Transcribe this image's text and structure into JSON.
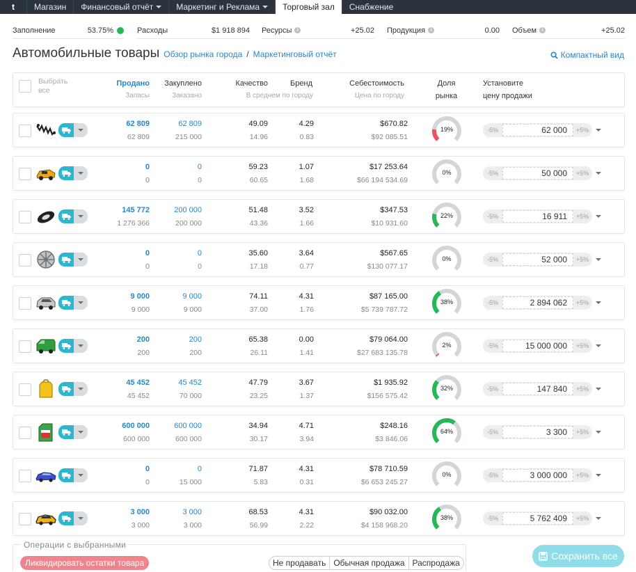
{
  "nav": {
    "logo": "t",
    "tabs": [
      {
        "label": "Магазин",
        "dropdown": false,
        "active": false
      },
      {
        "label": "Финансовый отчёт",
        "dropdown": true,
        "active": false
      },
      {
        "label": "Маркетинг и Реклама",
        "dropdown": true,
        "active": false
      },
      {
        "label": "Торговый зал",
        "dropdown": false,
        "active": true
      },
      {
        "label": "Снабжение",
        "dropdown": false,
        "active": false
      }
    ]
  },
  "stats": [
    {
      "label": "Заполнение",
      "value": "53.75%",
      "info": false,
      "dot": true
    },
    {
      "label": "Расходы",
      "value": "$1 918 894",
      "info": false,
      "dot": false
    },
    {
      "label": "Ресурсы",
      "value": "+25.02",
      "info": true,
      "dot": false
    },
    {
      "label": "Продукция",
      "value": "0.00",
      "info": true,
      "dot": false
    },
    {
      "label": "Объем",
      "value": "+25.02",
      "info": true,
      "dot": false
    }
  ],
  "heading": {
    "title": "Автомобильные товары",
    "link1": "Обзор рынка города",
    "sep": "/",
    "link2": "Маркетинговый отчёт",
    "compact": "Компактный вид"
  },
  "header": {
    "select": "Выбрать",
    "select2": "все",
    "sold": "Продано",
    "stock": "Запасы",
    "bought": "Закуплено",
    "ordered": "Заказано",
    "quality": "Качество",
    "brand": "Бренд",
    "avg": "В среднем по городу",
    "cost": "Себестоимость",
    "cityprice": "Цена по городу",
    "share1": "Доля",
    "share2": "рынка",
    "setprice1": "Установите",
    "setprice2": "цену продажи"
  },
  "rows": [
    {
      "icon": "spark-plug-wires",
      "sold": "62 809",
      "stock": "62 809",
      "bought": "62 809",
      "ordered": "215 000",
      "quality": "49.09",
      "quality_avg": "14.96",
      "brand": "4.29",
      "brand_avg": "0.83",
      "cost": "$670.82",
      "city_price": "$92 085.51",
      "share_label": "19%",
      "share": 19,
      "minus": "-5%",
      "price": "62 000",
      "plus": "+5%"
    },
    {
      "icon": "toy-car",
      "sold": "0",
      "stock": "0",
      "bought": "0",
      "ordered": "0",
      "quality": "59.23",
      "quality_avg": "60.65",
      "brand": "1.07",
      "brand_avg": "1.68",
      "cost": "$17 253.64",
      "city_price": "$66 194 534.69",
      "share_label": "0%",
      "share": 0,
      "minus": "-5%",
      "price": "50 000",
      "plus": "+5%"
    },
    {
      "icon": "tire",
      "sold": "145 772",
      "stock": "1 276 366",
      "bought": "200 000",
      "ordered": "200 000",
      "quality": "51.48",
      "quality_avg": "43.36",
      "brand": "3.52",
      "brand_avg": "1.66",
      "cost": "$347.53",
      "city_price": "$10 931.60",
      "share_label": "22%",
      "share": 22,
      "minus": "-5%",
      "price": "16 911",
      "plus": "+5%"
    },
    {
      "icon": "wheel-rim",
      "sold": "0",
      "stock": "0",
      "bought": "0",
      "ordered": "0",
      "quality": "35.60",
      "quality_avg": "17.18",
      "brand": "3.64",
      "brand_avg": "0.77",
      "cost": "$567.65",
      "city_price": "$130 077.17",
      "share_label": "0%",
      "share": 0,
      "minus": "-5%",
      "price": "52 000",
      "plus": "+5%"
    },
    {
      "icon": "suv",
      "sold": "9 000",
      "stock": "9 000",
      "bought": "9 000",
      "ordered": "9 000",
      "quality": "74.11",
      "quality_avg": "37.00",
      "brand": "4.31",
      "brand_avg": "1.76",
      "cost": "$87 165.00",
      "city_price": "$5 739 787.72",
      "share_label": "38%",
      "share": 38,
      "minus": "-5%",
      "price": "2 894 062",
      "plus": "+5%"
    },
    {
      "icon": "van",
      "sold": "200",
      "stock": "200",
      "bought": "200",
      "ordered": "200",
      "quality": "65.38",
      "quality_avg": "26.11",
      "brand": "0.00",
      "brand_avg": "1.41",
      "cost": "$79 064.00",
      "city_price": "$27 683 135.78",
      "share_label": "2%",
      "share": 2,
      "minus": "-5%",
      "price": "15 000 000",
      "plus": "+5%"
    },
    {
      "icon": "jerry-can",
      "sold": "45 452",
      "stock": "45 452",
      "bought": "45 452",
      "ordered": "70 000",
      "quality": "47.79",
      "quality_avg": "23.25",
      "brand": "3.67",
      "brand_avg": "1.37",
      "cost": "$1 935.92",
      "city_price": "$156 575.42",
      "share_label": "32%",
      "share": 32,
      "minus": "-5%",
      "price": "147 840",
      "plus": "+5%"
    },
    {
      "icon": "oil-canister",
      "sold": "600 000",
      "stock": "600 000",
      "bought": "600 000",
      "ordered": "600 000",
      "quality": "34.94",
      "quality_avg": "30.17",
      "brand": "4.71",
      "brand_avg": "3.94",
      "cost": "$248.16",
      "city_price": "$3 846.06",
      "share_label": "64%",
      "share": 64,
      "minus": "-5%",
      "price": "3 300",
      "plus": "+5%"
    },
    {
      "icon": "sports-car",
      "sold": "0",
      "stock": "0",
      "bought": "0",
      "ordered": "15 000",
      "quality": "71.87",
      "quality_avg": "5.83",
      "brand": "4.31",
      "brand_avg": "0.31",
      "cost": "$78 710.59",
      "city_price": "$6 653 245.27",
      "share_label": "0%",
      "share": 0,
      "minus": "-5%",
      "price": "3 000 000",
      "plus": "+5%"
    },
    {
      "icon": "yellow-car",
      "sold": "3 000",
      "stock": "3 000",
      "bought": "3 000",
      "ordered": "3 000",
      "quality": "68.53",
      "quality_avg": "56.99",
      "brand": "4.31",
      "brand_avg": "2.22",
      "cost": "$90 032.00",
      "city_price": "$4 158 968.20",
      "share_label": "38%",
      "share": 38,
      "minus": "-5%",
      "price": "5 762 409",
      "plus": "+5%"
    }
  ],
  "ops": {
    "legend": "Операции с выбранными",
    "liquidate": "Ликвидировать остатки товара",
    "modes": [
      "Не продавать",
      "Обычная продажа",
      "Распродажа"
    ],
    "save": "Сохранить все"
  },
  "colors": {
    "accent": "#2a86c4",
    "nav": "#2b343c",
    "truck": "#2fb6cf",
    "green": "#27b856",
    "red": "#e55560",
    "save": "#8fdde8"
  }
}
